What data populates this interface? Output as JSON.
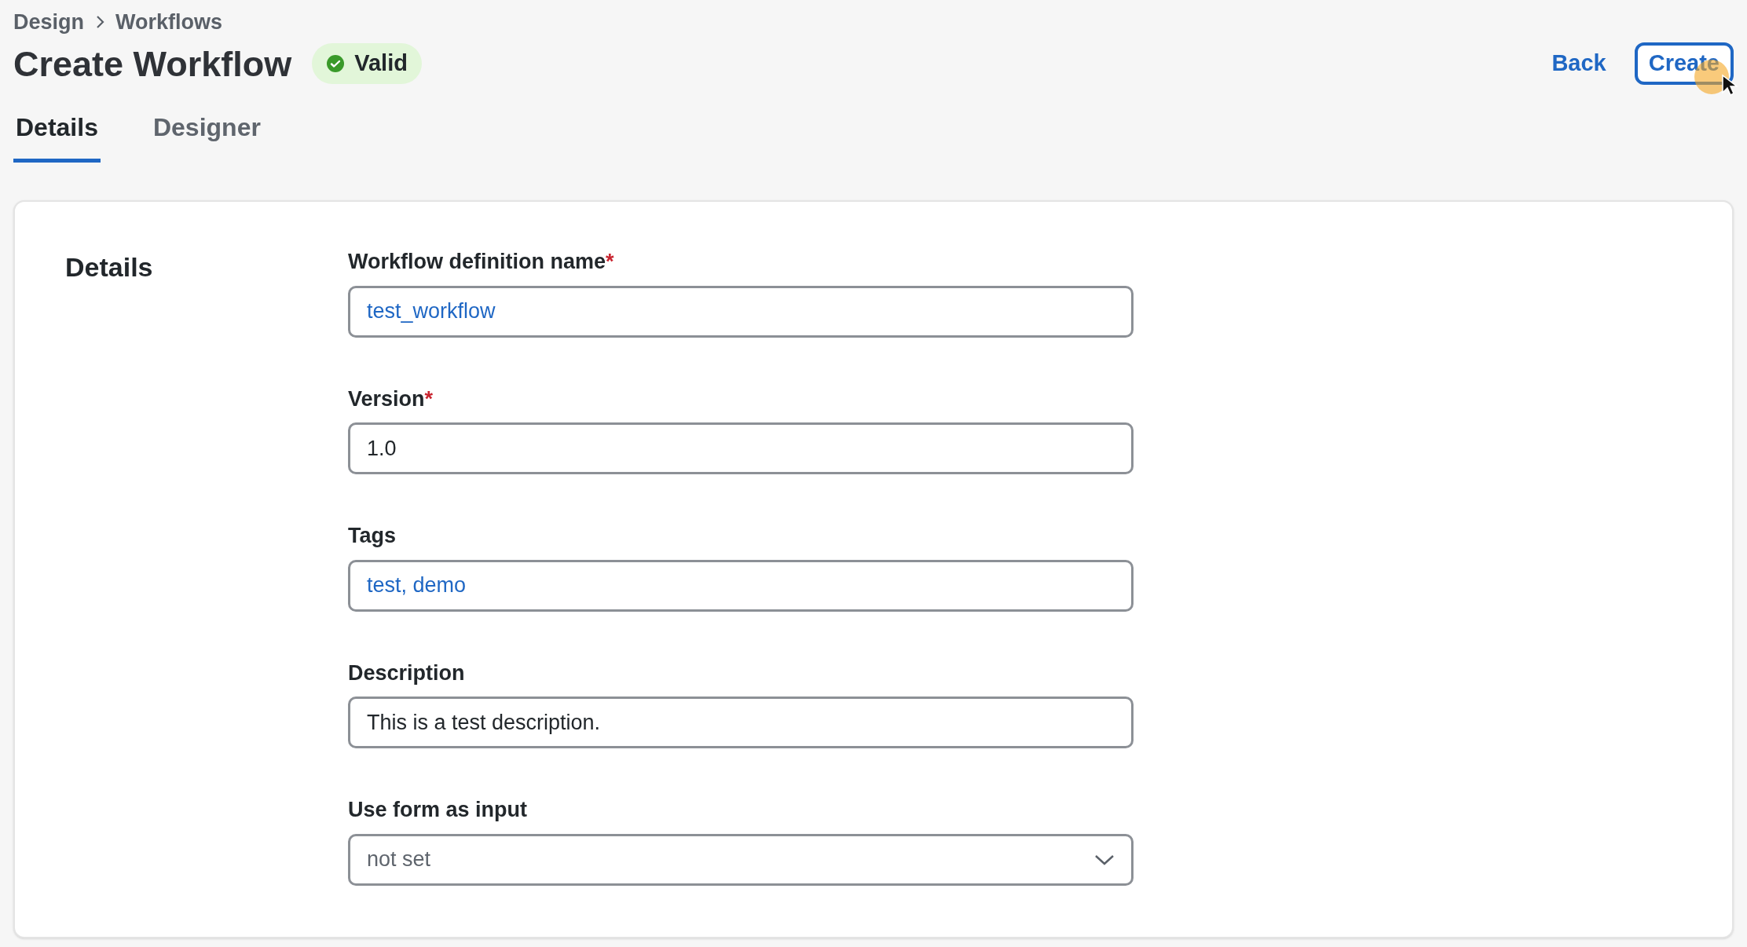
{
  "breadcrumb": [
    "Design",
    "Workflows"
  ],
  "title": "Create Workflow",
  "status_badge": {
    "label": "Valid"
  },
  "actions": {
    "back": "Back",
    "create": "Create"
  },
  "tabs": [
    {
      "label": "Details",
      "selected": true
    },
    {
      "label": "Designer",
      "selected": false
    }
  ],
  "section": {
    "heading": "Details",
    "fields": [
      {
        "kind": "text",
        "label": "Workflow definition name",
        "required_mark": "*",
        "value": "test_workflow",
        "highlighted": true
      },
      {
        "kind": "text",
        "label": "Version",
        "required_mark": "*",
        "value": "1.0",
        "highlighted": false
      },
      {
        "kind": "text",
        "label": "Tags",
        "value": "test, demo",
        "highlighted": true
      },
      {
        "kind": "text",
        "label": "Description",
        "value": "This is a test description.",
        "highlighted": false
      },
      {
        "kind": "select",
        "label": "Use form as input",
        "value": "not set",
        "highlighted": false
      }
    ]
  }
}
